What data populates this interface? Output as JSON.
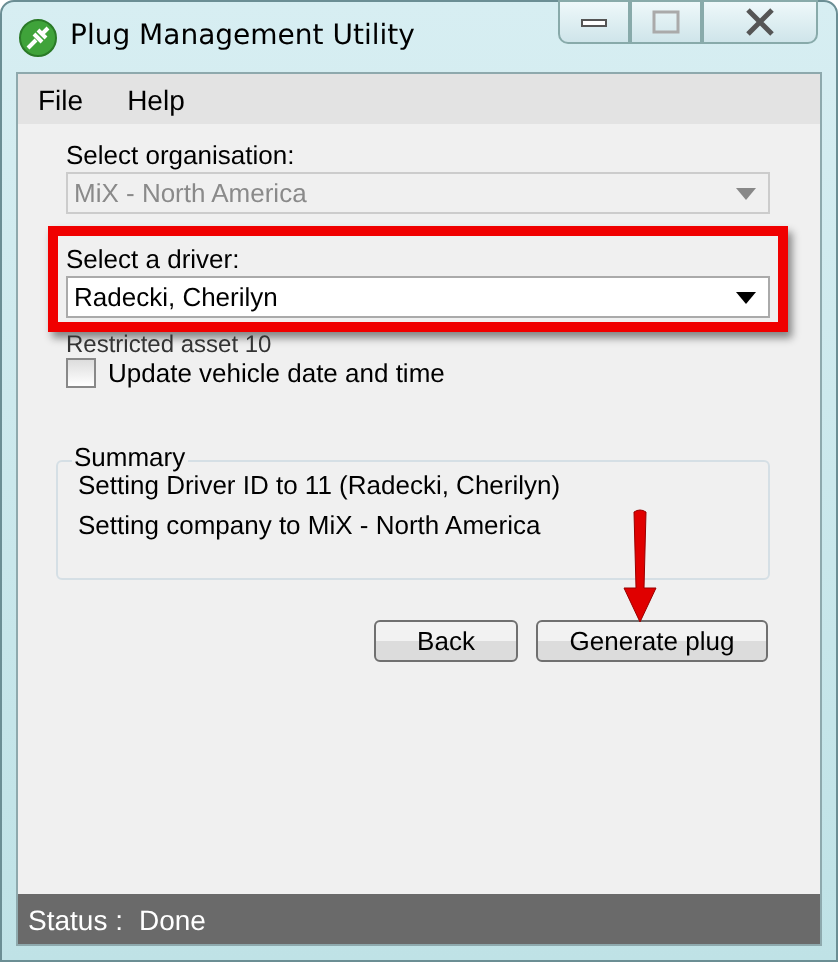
{
  "window": {
    "title": "Plug Management Utility"
  },
  "menu": [
    "File",
    "Help"
  ],
  "organisation": {
    "label": "Select organisation:",
    "value": "MiX - North America",
    "disabled": true
  },
  "driver": {
    "label": "Select a driver:",
    "value": "Radecki, Cherilyn",
    "highlighted": true
  },
  "note": "Restricted asset 10",
  "update_time": {
    "label": "Update vehicle date and time",
    "checked": false
  },
  "summary": {
    "title": "Summary",
    "lines": [
      "Setting Driver ID to 11 (Radecki, Cherilyn)",
      "Setting company to MiX - North America"
    ]
  },
  "buttons": [
    "Back",
    "Generate plug"
  ],
  "status": {
    "label": "Status :",
    "value": "Done"
  }
}
